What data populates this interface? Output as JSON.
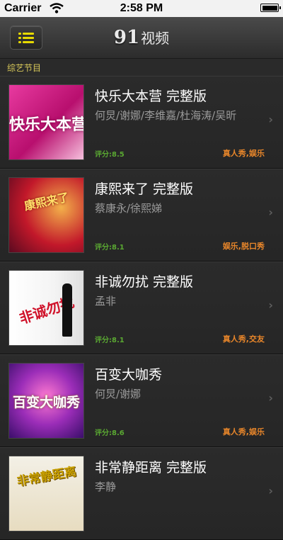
{
  "status_bar": {
    "carrier": "Carrier",
    "time": "2:58 PM"
  },
  "nav": {
    "brand_number": "91",
    "brand_text": "视频",
    "menu_icon": "menu-icon"
  },
  "section": {
    "label": "综艺节目"
  },
  "items": [
    {
      "title": "快乐大本营 完整版",
      "cast": "何炅/谢娜/李维嘉/杜海涛/吴昕",
      "rating": "评分:8.5",
      "tags": "真人秀,娱乐",
      "thumb_text": "快乐大本营"
    },
    {
      "title": "康熙来了 完整版",
      "cast": "蔡康永/徐熙娣",
      "rating": "评分:8.1",
      "tags": "娱乐,脱口秀",
      "thumb_text": "康熙来了"
    },
    {
      "title": "非诚勿扰 完整版",
      "cast": "孟非",
      "rating": "评分:8.1",
      "tags": "真人秀,交友",
      "thumb_text": "非诚勿扰"
    },
    {
      "title": "百变大咖秀",
      "cast": "何炅/谢娜",
      "rating": "评分:8.6",
      "tags": "真人秀,娱乐",
      "thumb_text": "百变大咖秀"
    },
    {
      "title": "非常静距离 完整版",
      "cast": "李静",
      "rating": "",
      "tags": "",
      "thumb_text": "非常静距离"
    }
  ],
  "colors": {
    "accent_yellow": "#e6d900",
    "rating_green": "#5aa832",
    "tag_orange": "#e8862a"
  }
}
